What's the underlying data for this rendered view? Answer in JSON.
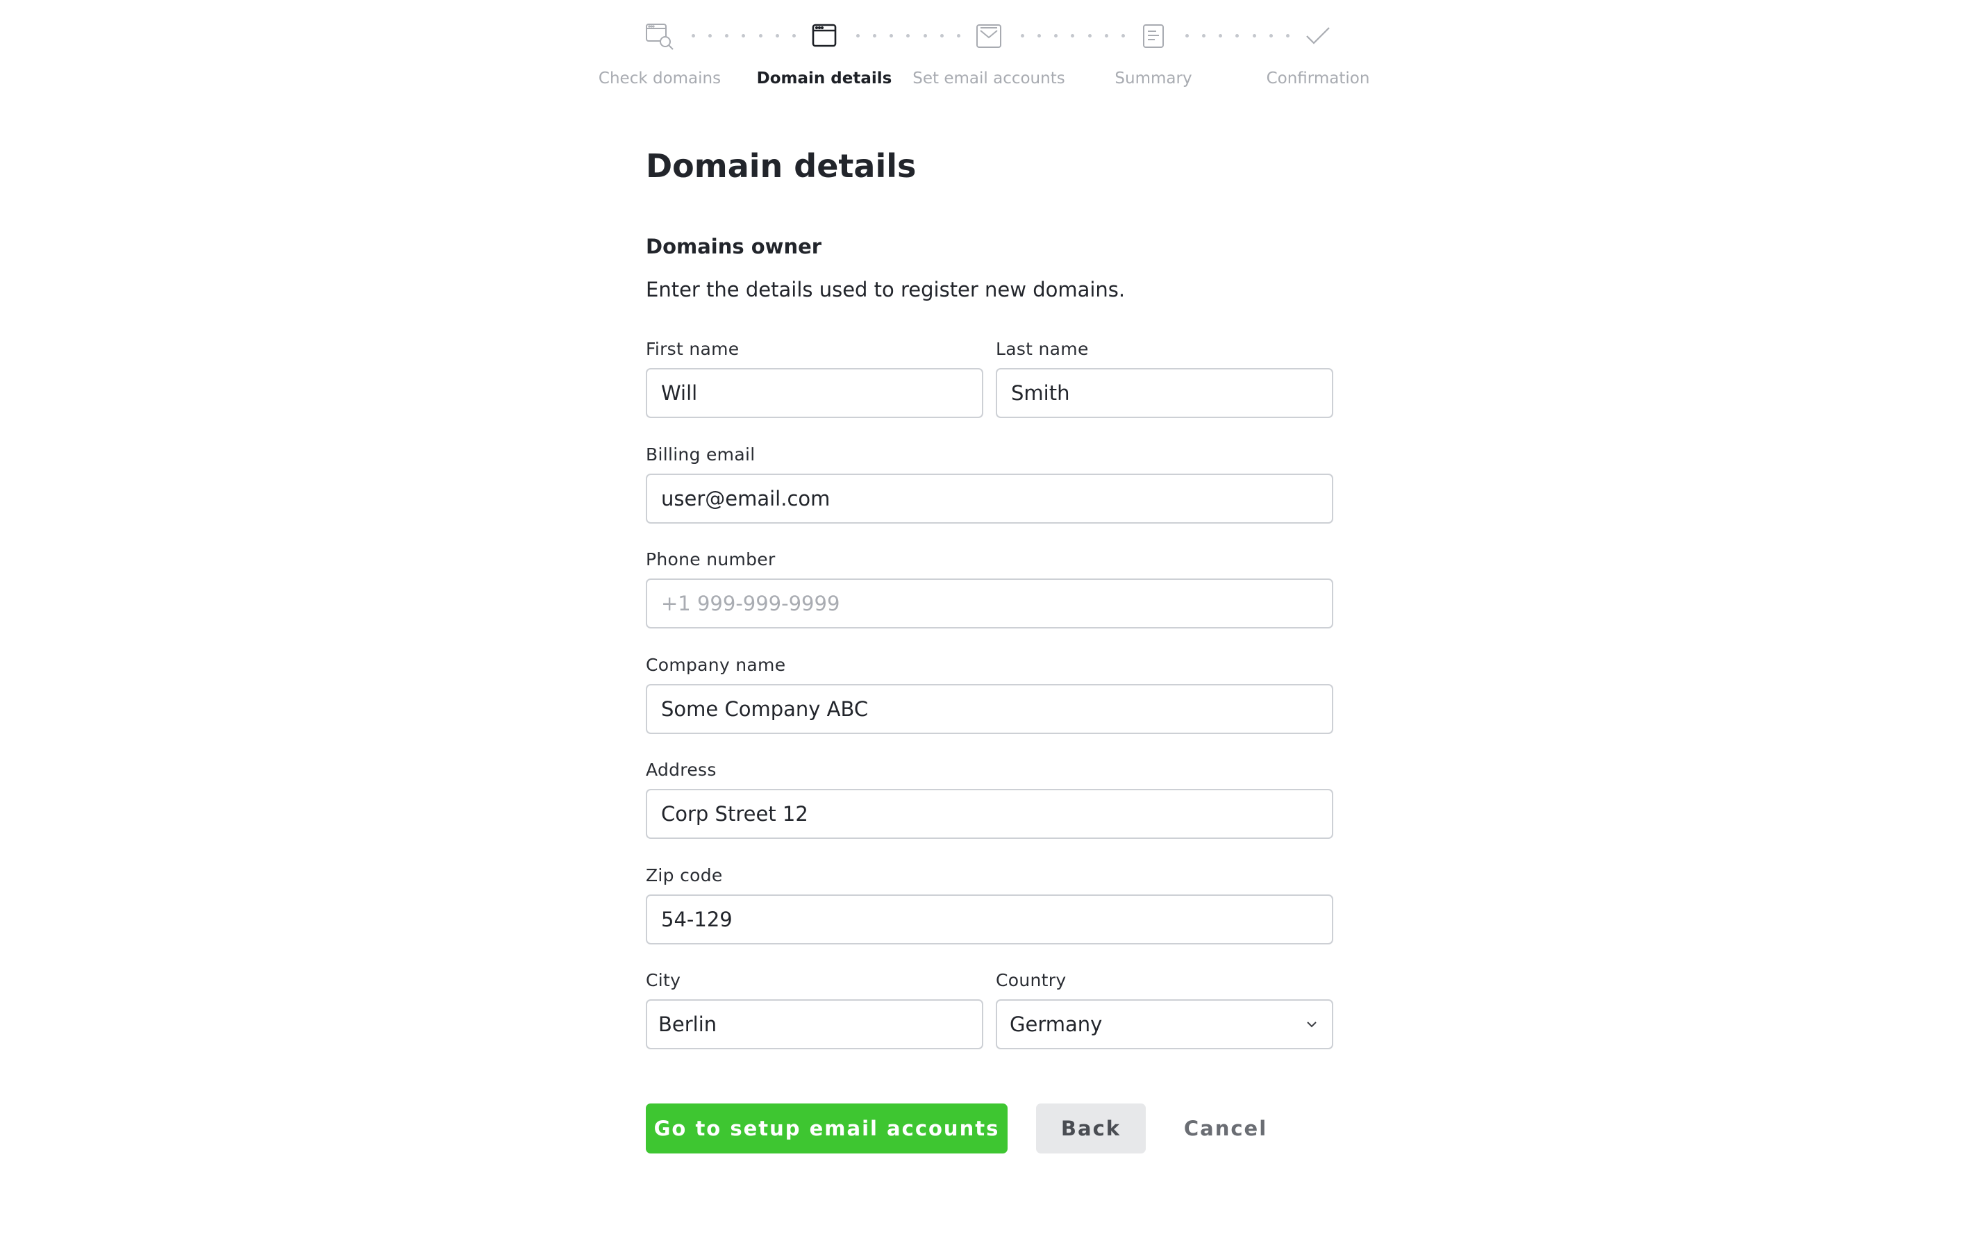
{
  "stepper": {
    "steps": [
      {
        "label": "Check domains",
        "icon": "domain-search-icon",
        "state": "inactive"
      },
      {
        "label": "Domain details",
        "icon": "browser-window-icon",
        "state": "active"
      },
      {
        "label": "Set email accounts",
        "icon": "email-inbox-icon",
        "state": "inactive"
      },
      {
        "label": "Summary",
        "icon": "document-icon",
        "state": "inactive"
      },
      {
        "label": "Confirmation",
        "icon": "checkmark-icon",
        "state": "inactive"
      }
    ]
  },
  "page": {
    "title": "Domain details",
    "section_title": "Domains owner",
    "section_description": "Enter the details used to register new domains."
  },
  "form": {
    "first_name": {
      "label": "First name",
      "value": "Will"
    },
    "last_name": {
      "label": "Last name",
      "value": "Smith"
    },
    "billing_email": {
      "label": "Billing email",
      "value": "user@email.com"
    },
    "phone_number": {
      "label": "Phone number",
      "value": "",
      "placeholder": "+1 999-999-9999"
    },
    "company_name": {
      "label": "Company name",
      "value": "Some Company ABC"
    },
    "address": {
      "label": "Address",
      "value": "Corp Street 12"
    },
    "zip_code": {
      "label": "Zip code",
      "value": "54-129"
    },
    "city": {
      "label": "City",
      "value": "Berlin"
    },
    "country": {
      "label": "Country",
      "value": "Germany"
    }
  },
  "actions": {
    "primary": "Go to setup email accounts",
    "back": "Back",
    "cancel": "Cancel"
  },
  "colors": {
    "accent": "#3ec631",
    "text": "#22252b",
    "muted": "#a8abb1",
    "border": "#cdd0d5"
  }
}
